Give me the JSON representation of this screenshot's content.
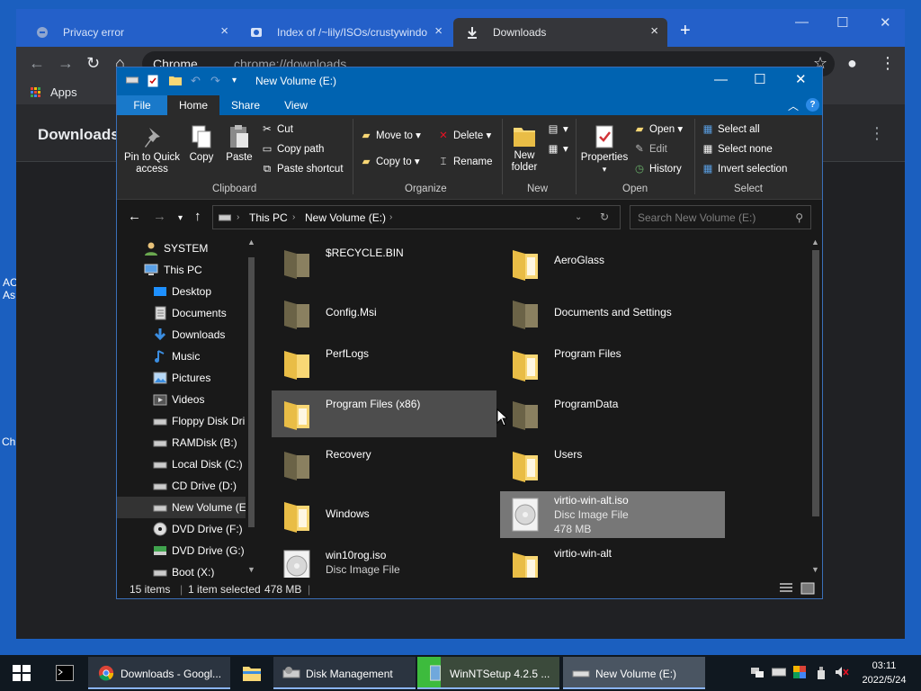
{
  "desktop": {
    "fragments": [
      "AC",
      "As",
      "Ch"
    ]
  },
  "chrome": {
    "tabs": [
      {
        "label": "Privacy error",
        "icon": "privacy-error-icon"
      },
      {
        "label": "Index of /~lily/ISOs/crustywindo",
        "icon": "site-icon"
      },
      {
        "label": "Downloads",
        "icon": "download-icon"
      }
    ],
    "new_tab": "+",
    "omnibox": {
      "site": "Chrome",
      "url": "chrome://downloads"
    },
    "bookmarks": {
      "apps_label": "Apps"
    },
    "page_title": "Downloads"
  },
  "explorer": {
    "title": "New Volume (E:)",
    "ribbon_tabs": [
      "File",
      "Home",
      "Share",
      "View"
    ],
    "clipboard": {
      "pin_label": "Pin to Quick access",
      "copy_label": "Copy",
      "paste_label": "Paste",
      "cut_label": "Cut",
      "copy_path_label": "Copy path",
      "paste_shortcut_label": "Paste shortcut",
      "group_label": "Clipboard"
    },
    "organize": {
      "move_to_label": "Move to",
      "copy_to_label": "Copy to",
      "delete_label": "Delete",
      "rename_label": "Rename",
      "group_label": "Organize"
    },
    "new": {
      "new_folder_label": "New folder",
      "group_label": "New"
    },
    "open": {
      "properties_label": "Properties",
      "open_label": "Open",
      "edit_label": "Edit",
      "history_label": "History",
      "group_label": "Open"
    },
    "select": {
      "select_all_label": "Select all",
      "select_none_label": "Select none",
      "invert_label": "Invert selection",
      "group_label": "Select"
    },
    "address": {
      "crumbs": [
        "This PC",
        "New Volume (E:)"
      ]
    },
    "search": {
      "placeholder": "Search New Volume (E:)"
    },
    "nav_items": [
      {
        "label": "SYSTEM",
        "icon": "user-icon"
      },
      {
        "label": "This PC",
        "icon": "pc-icon"
      },
      {
        "label": "Desktop",
        "icon": "desktop-icon"
      },
      {
        "label": "Documents",
        "icon": "documents-icon"
      },
      {
        "label": "Downloads",
        "icon": "downloads-icon"
      },
      {
        "label": "Music",
        "icon": "music-icon"
      },
      {
        "label": "Pictures",
        "icon": "pictures-icon"
      },
      {
        "label": "Videos",
        "icon": "videos-icon"
      },
      {
        "label": "Floppy Disk Dri",
        "icon": "floppy-drive-icon"
      },
      {
        "label": "RAMDisk (B:)",
        "icon": "drive-icon"
      },
      {
        "label": "Local Disk (C:)",
        "icon": "drive-icon"
      },
      {
        "label": "CD Drive (D:)",
        "icon": "cd-drive-icon"
      },
      {
        "label": "New Volume (E",
        "icon": "drive-icon"
      },
      {
        "label": "DVD Drive (F:) v",
        "icon": "dvd-drive-icon"
      },
      {
        "label": "DVD Drive (G:)",
        "icon": "dvd-drive-icon"
      },
      {
        "label": "Boot (X:)",
        "icon": "drive-icon"
      }
    ],
    "files": [
      {
        "name": "$RECYCLE.BIN",
        "type": "folder-dim"
      },
      {
        "name": "AeroGlass",
        "type": "folder-docs"
      },
      {
        "name": "Config.Msi",
        "type": "folder-dim"
      },
      {
        "name": "Documents and Settings",
        "type": "folder-dim"
      },
      {
        "name": "PerfLogs",
        "type": "folder"
      },
      {
        "name": "Program Files",
        "type": "folder-docs"
      },
      {
        "name": "Program Files (x86)",
        "type": "folder-docs"
      },
      {
        "name": "ProgramData",
        "type": "folder-dim"
      },
      {
        "name": "Recovery",
        "type": "folder-dim"
      },
      {
        "name": "Users",
        "type": "folder-docs"
      },
      {
        "name": "Windows",
        "type": "folder-docs"
      },
      {
        "name": "virtio-win-alt.iso",
        "type": "disc",
        "kind": "Disc Image File",
        "size": "478 MB"
      },
      {
        "name": "win10rog.iso",
        "type": "disc",
        "kind": "Disc Image File"
      },
      {
        "name": "virtio-win-alt",
        "type": "folder-docs"
      }
    ],
    "status": {
      "count": "15 items",
      "selected": "1 item selected",
      "size": "478 MB"
    }
  },
  "taskbar": {
    "items": [
      {
        "label": "Downloads - Googl..."
      },
      {
        "label": "Disk Management"
      },
      {
        "label": "WinNTSetup 4.2.5  ..."
      },
      {
        "label": "New Volume (E:)"
      }
    ],
    "clock": {
      "time": "03:11",
      "date": "2022/5/24"
    }
  },
  "colors": {
    "title_blue": "#0063b1",
    "chrome_tab_bar": "#2460c9",
    "selection_gray": "#777777",
    "folder_yellow": "#f8d775"
  }
}
